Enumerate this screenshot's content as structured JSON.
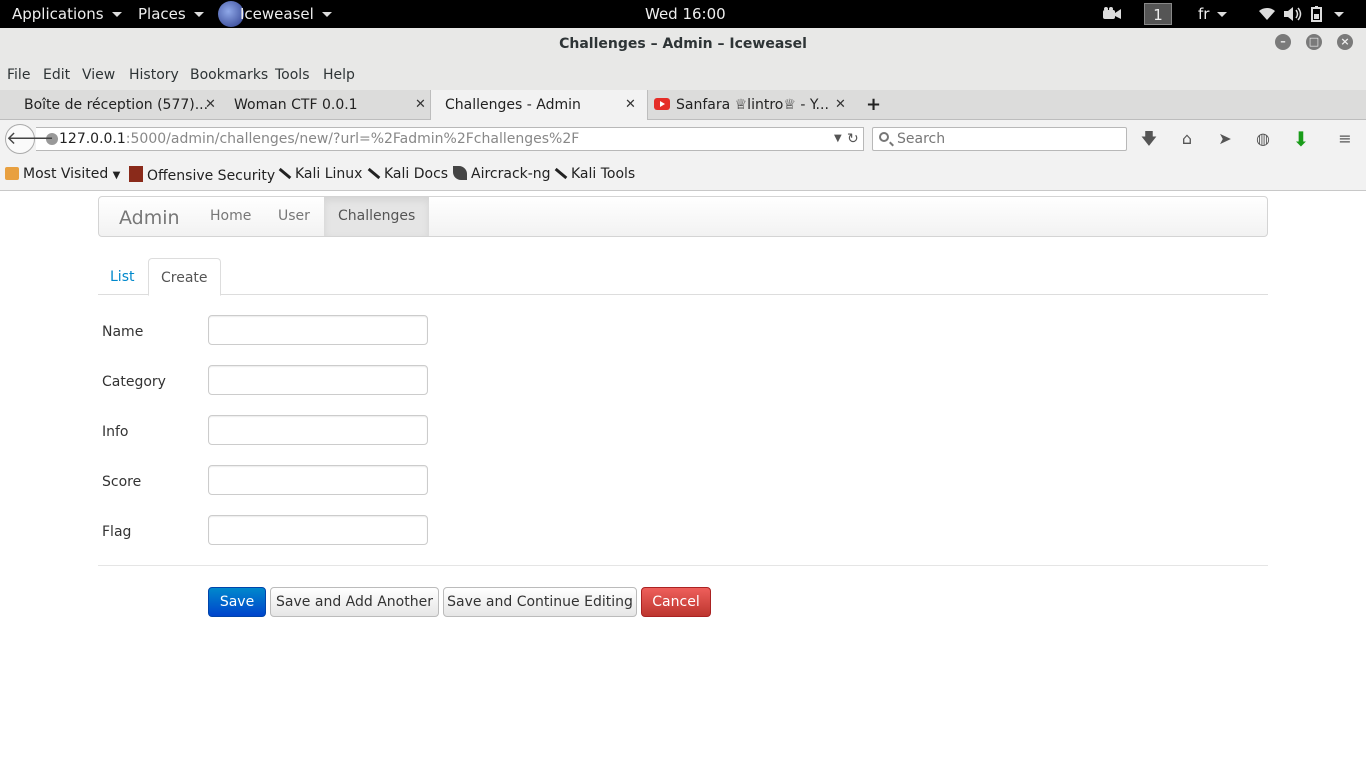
{
  "system_bar": {
    "applications": "Applications",
    "places": "Places",
    "active_app": "Iceweasel",
    "clock": "Wed 16:00",
    "workspace": "1",
    "keyboard_layout": "fr"
  },
  "window": {
    "title": "Challenges – Admin – Iceweasel"
  },
  "menu": {
    "file": "File",
    "edit": "Edit",
    "view": "View",
    "history": "History",
    "bookmarks": "Bookmarks",
    "tools": "Tools",
    "help": "Help"
  },
  "tabs": [
    {
      "label": "Boîte de réception (577)..."
    },
    {
      "label": "Woman CTF 0.0.1"
    },
    {
      "label": "Challenges - Admin"
    },
    {
      "label": "Sanfara ♕lintro♕ - Y..."
    }
  ],
  "navigation": {
    "url_host": "127.0.0.1",
    "url_rest": ":5000/admin/challenges/new/?url=%2Fadmin%2Fchallenges%2F",
    "search_placeholder": "Search"
  },
  "bookmarks_bar": {
    "most_visited": "Most Visited",
    "offensive_security": "Offensive Security",
    "kali_linux": "Kali Linux",
    "kali_docs": "Kali Docs",
    "aircrack": "Aircrack-ng",
    "kali_tools": "Kali Tools"
  },
  "admin_nav": {
    "brand": "Admin",
    "home": "Home",
    "user": "User",
    "challenges": "Challenges"
  },
  "page_tabs": {
    "list": "List",
    "create": "Create"
  },
  "form": {
    "name_label": "Name",
    "category_label": "Category",
    "info_label": "Info",
    "score_label": "Score",
    "flag_label": "Flag",
    "name_value": "",
    "category_value": "",
    "info_value": "",
    "score_value": "",
    "flag_value": ""
  },
  "actions": {
    "save": "Save",
    "save_add": "Save and Add Another",
    "save_continue": "Save and Continue Editing",
    "cancel": "Cancel"
  },
  "colors": {
    "primary": "#0066cc",
    "danger": "#d9534f",
    "link": "#0088cc"
  }
}
